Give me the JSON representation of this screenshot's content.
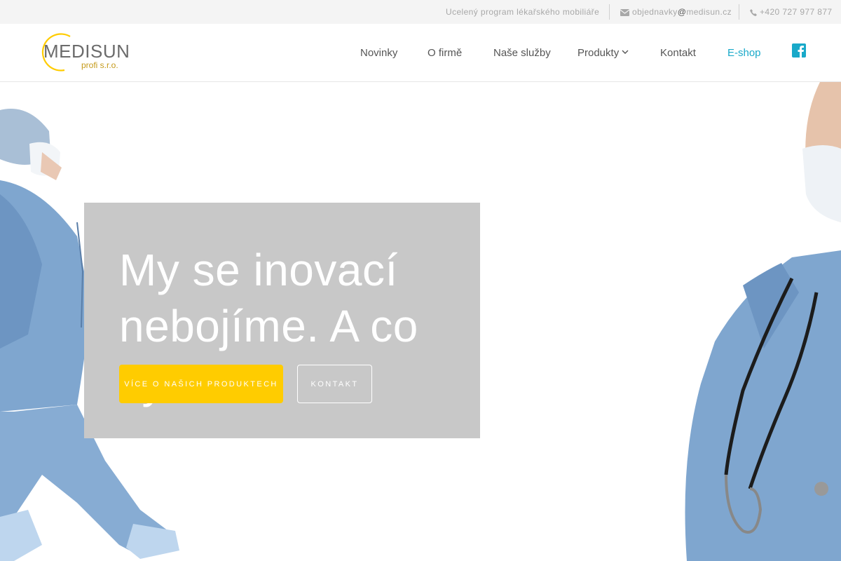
{
  "topbar": {
    "tagline": "Ucelený program lékařského mobiliáře",
    "email_prefix": "objednavky",
    "email_at": "@",
    "email_domain": "medisun.cz",
    "phone": "+420 727 977 877"
  },
  "logo": {
    "brand": "MEDISUN",
    "sub": "profi s.r.o."
  },
  "nav": {
    "items": [
      "Novinky",
      "O firmě",
      "Naše služby",
      "Produkty",
      "Kontakt",
      "E-shop"
    ]
  },
  "hero": {
    "headline_line1": "My se inovací",
    "headline_line2": "nebojíme. A co vy?",
    "primary_button": "VÍCE O NAŠICH PRODUKTECH",
    "secondary_button": "KONTAKT"
  },
  "icons": {
    "email": "envelope-icon",
    "phone": "phone-icon",
    "dropdown": "chevron-down-icon",
    "social": "facebook-icon"
  },
  "colors": {
    "accent": "#19a9c9",
    "button": "#ffcc00",
    "panel": "#c8c8c8",
    "scrubs": "#7fa6cf"
  }
}
